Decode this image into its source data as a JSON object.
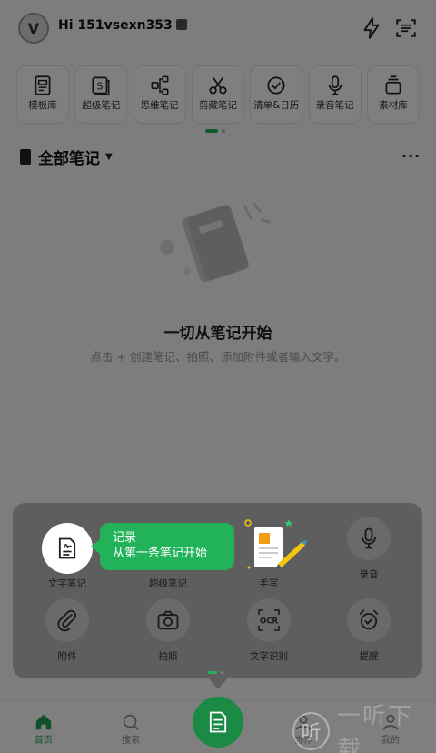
{
  "header": {
    "avatar_text": "V",
    "greeting": "Hi 151vsexn353"
  },
  "tools": [
    {
      "label": "模板库",
      "icon": "template-icon"
    },
    {
      "label": "超级笔记",
      "icon": "super-note-icon"
    },
    {
      "label": "思维笔记",
      "icon": "mindmap-icon"
    },
    {
      "label": "剪藏笔记",
      "icon": "scissors-icon"
    },
    {
      "label": "清单&日历",
      "icon": "checklist-icon"
    },
    {
      "label": "录音笔记",
      "icon": "microphone-icon"
    },
    {
      "label": "素材库",
      "icon": "material-icon"
    }
  ],
  "section": {
    "title": "全部笔记",
    "more": "···"
  },
  "empty": {
    "title": "一切从笔记开始",
    "subtitle": "点击 + 创建笔记、拍照、添加附件或者输入文字。"
  },
  "sheet": {
    "items": [
      {
        "label": "文字笔记"
      },
      {
        "label": "超级笔记"
      },
      {
        "label": "手写"
      },
      {
        "label": "录音"
      },
      {
        "label": "附件"
      },
      {
        "label": "拍照"
      },
      {
        "label": "文字识别"
      },
      {
        "label": "提醒"
      }
    ],
    "ocr_text": "OCR",
    "tooltip_line1": "记录",
    "tooltip_line2": "从第一条笔记开始"
  },
  "nav": {
    "items": [
      {
        "label": "首页"
      },
      {
        "label": "搜索"
      },
      {
        "label": "协作"
      },
      {
        "label": "我的"
      }
    ]
  },
  "watermark": {
    "glyph": "听",
    "text": "一听下载"
  },
  "colors": {
    "accent": "#22b25a",
    "overlay_sheet": "#5e5e5e"
  }
}
